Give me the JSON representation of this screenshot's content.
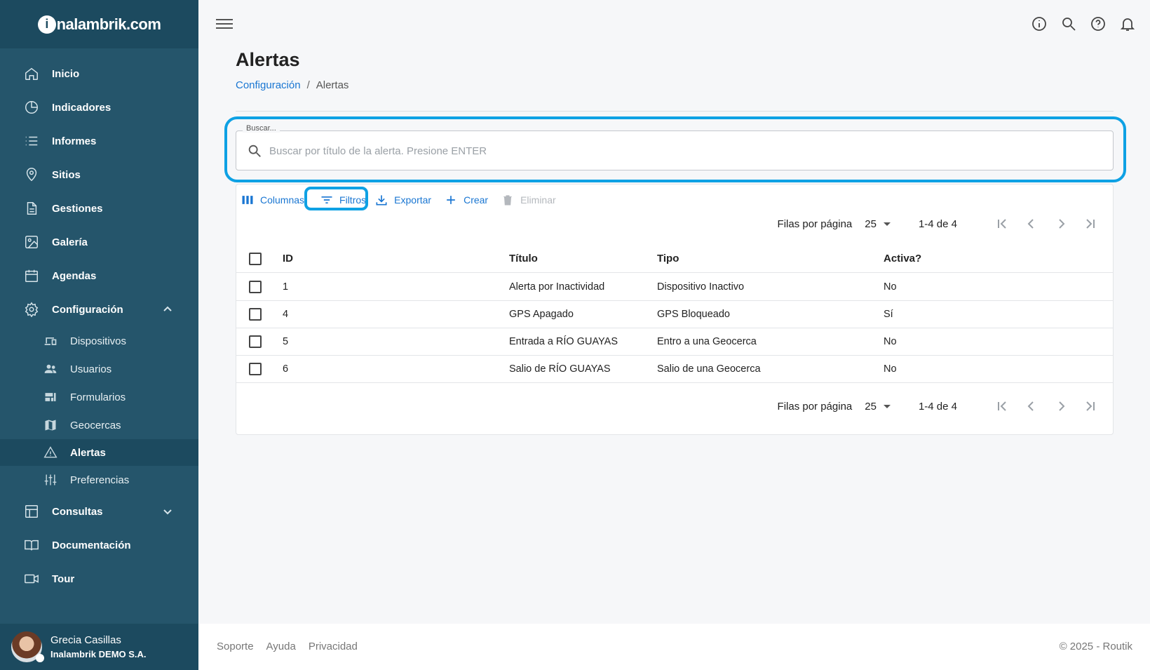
{
  "brand": {
    "logo_mark": "i",
    "logo_text": "nalambrik.com"
  },
  "sidebar": {
    "items": [
      {
        "label": "Inicio",
        "icon": "home-icon"
      },
      {
        "label": "Indicadores",
        "icon": "pie-chart-icon"
      },
      {
        "label": "Informes",
        "icon": "list-icon"
      },
      {
        "label": "Sitios",
        "icon": "location-pin-icon"
      },
      {
        "label": "Gestiones",
        "icon": "document-icon"
      },
      {
        "label": "Galería",
        "icon": "image-icon"
      },
      {
        "label": "Agendas",
        "icon": "calendar-icon"
      },
      {
        "label": "Configuración",
        "icon": "gear-icon",
        "expanded": true
      },
      {
        "label": "Consultas",
        "icon": "table-icon",
        "expanded": false
      },
      {
        "label": "Documentación",
        "icon": "book-icon"
      },
      {
        "label": "Tour",
        "icon": "video-camera-icon"
      }
    ],
    "sub_items": [
      {
        "label": "Dispositivos",
        "icon": "devices-icon"
      },
      {
        "label": "Usuarios",
        "icon": "people-icon"
      },
      {
        "label": "Formularios",
        "icon": "forms-icon"
      },
      {
        "label": "Geocercas",
        "icon": "map-icon"
      },
      {
        "label": "Alertas",
        "icon": "warning-icon",
        "active": true
      },
      {
        "label": "Preferencias",
        "icon": "sliders-icon"
      }
    ]
  },
  "user": {
    "name": "Grecia Casillas",
    "org": "Inalambrik DEMO S.A."
  },
  "header": {
    "title": "Alertas",
    "breadcrumb_parent": "Configuración",
    "breadcrumb_sep": "/",
    "breadcrumb_current": "Alertas"
  },
  "search": {
    "label": "Buscar...",
    "placeholder": "Buscar por título de la alerta. Presione ENTER",
    "value": ""
  },
  "toolbar": {
    "columns": "Columnas",
    "filters": "Filtros",
    "export": "Exportar",
    "create": "Crear",
    "delete": "Eliminar"
  },
  "pagination": {
    "rows_label": "Filas por página",
    "rows_value": "25",
    "range": "1-4 de 4"
  },
  "table": {
    "columns": [
      "ID",
      "Título",
      "Tipo",
      "Activa?"
    ],
    "rows": [
      {
        "id": "1",
        "titulo": "Alerta por Inactividad",
        "tipo": "Dispositivo Inactivo",
        "activa": "No"
      },
      {
        "id": "4",
        "titulo": "GPS Apagado",
        "tipo": "GPS Bloqueado",
        "activa": "Sí"
      },
      {
        "id": "5",
        "titulo": "Entrada a RÍO GUAYAS",
        "tipo": "Entro a una Geocerca",
        "activa": "No"
      },
      {
        "id": "6",
        "titulo": "Salio de RÍO GUAYAS",
        "tipo": "Salio de una Geocerca",
        "activa": "No"
      }
    ]
  },
  "footer": {
    "links": [
      "Soporte",
      "Ayuda",
      "Privacidad"
    ],
    "copyright": "© 2025 - Routik"
  },
  "colors": {
    "sidebar": "#25556b",
    "sidebar_dark": "#1c4a5f",
    "accent": "#1976d2",
    "highlight": "#0ea1e4"
  }
}
